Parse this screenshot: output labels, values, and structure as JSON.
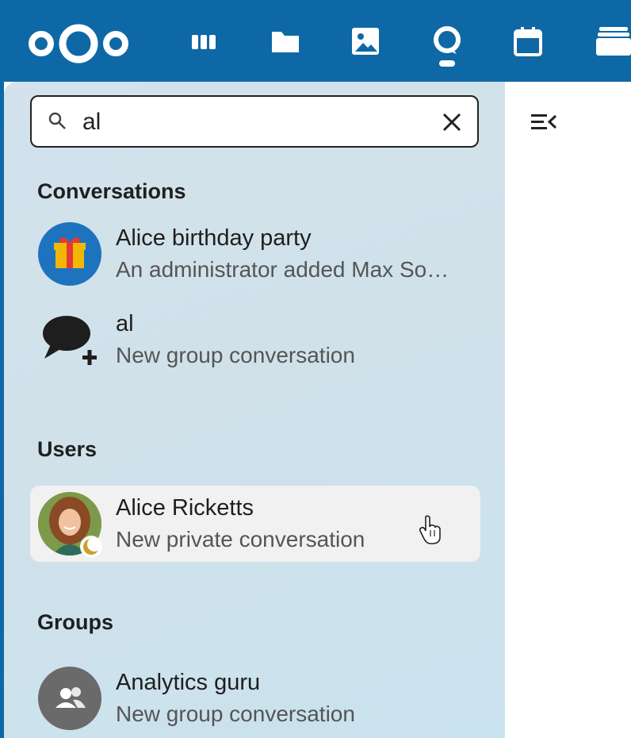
{
  "topbar": {
    "logo_icon": "nextcloud-logo",
    "apps": [
      {
        "icon": "deck-icon"
      },
      {
        "icon": "folder-icon"
      },
      {
        "icon": "image-icon"
      },
      {
        "icon": "talk-icon"
      },
      {
        "icon": "calendar-icon"
      },
      {
        "icon": "stack-icon"
      }
    ],
    "color": "#0f68a6"
  },
  "search": {
    "value": "al",
    "icon": "search-icon",
    "clear_icon": "close-icon"
  },
  "sidebar_toggle_icon": "menu-collapse-icon",
  "sections": {
    "conversations": {
      "heading": "Conversations",
      "items": [
        {
          "title": "Alice birthday party",
          "subtitle": "An administrator added Max So…",
          "icon": "gift-icon"
        },
        {
          "title": "al",
          "subtitle": "New group conversation",
          "icon": "new-chat-icon"
        }
      ]
    },
    "users": {
      "heading": "Users",
      "items": [
        {
          "title": "Alice Ricketts",
          "subtitle": "New private conversation",
          "icon": "user-avatar",
          "status_icon": "moon-icon"
        }
      ]
    },
    "groups": {
      "heading": "Groups",
      "items": [
        {
          "title": "Analytics guru",
          "subtitle": "New group conversation",
          "icon": "group-icon"
        }
      ]
    }
  },
  "cursor_icon": "hand-pointer-icon"
}
